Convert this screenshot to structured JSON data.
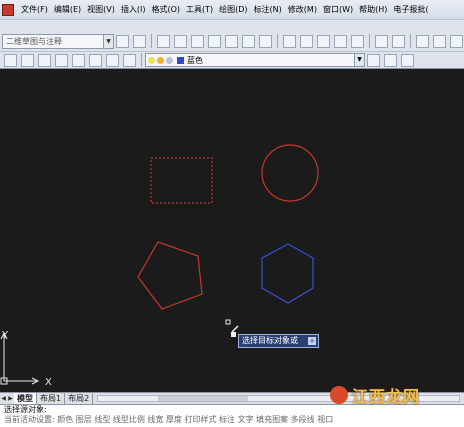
{
  "menubar": {
    "items": [
      "文件(F)",
      "编辑(E)",
      "视图(V)",
      "插入(I)",
      "格式(O)",
      "工具(T)",
      "绘图(D)",
      "标注(N)",
      "修改(M)",
      "窗口(W)",
      "帮助(H)",
      "电子报批("
    ]
  },
  "toolbar": {
    "workspace_value": "二维草图与注释"
  },
  "layer": {
    "current": "蓝色",
    "colors": {
      "on": "#f3e15a",
      "sun": "#f0b030",
      "swatch": "#3446c9"
    }
  },
  "canvas": {
    "background": "#1b1b1b",
    "shape_colors": {
      "red": "#c0392b",
      "blue": "#3a4ecf"
    },
    "ucs": {
      "x_label": "X",
      "y_label": "Y"
    }
  },
  "tooltip": {
    "text": "选择目标对象或",
    "button": "+"
  },
  "tabs": {
    "nav": [
      "◀",
      "▶"
    ],
    "items": [
      "模型",
      "布局1",
      "布局2"
    ],
    "active": "模型"
  },
  "command": {
    "line1": "选择源对象:",
    "line2": "当前活动设置: 颜色 图层 线型 线型比例 线宽 厚度 打印样式 标注 文字 填充图案 多段线 视口"
  },
  "watermark": {
    "text": "江西龙网"
  }
}
